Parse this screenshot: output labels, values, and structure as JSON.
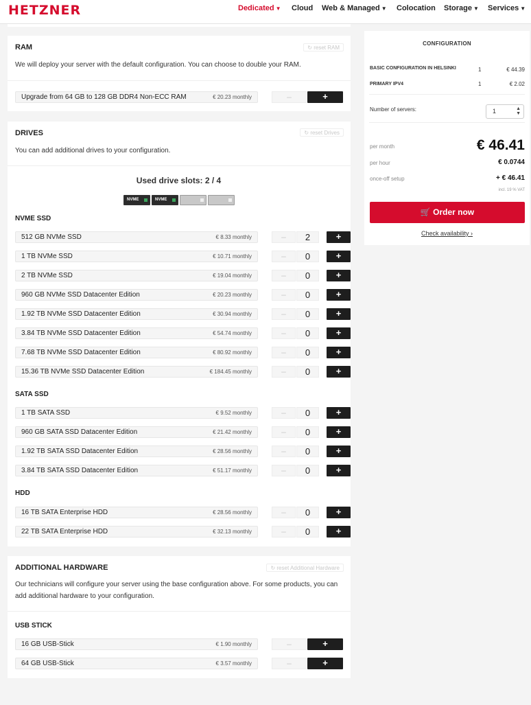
{
  "brand": {
    "logo": "HETZNER",
    "accent": "#d50c2d"
  },
  "nav": [
    {
      "label": "Dedicated",
      "dropdown": true,
      "active": true
    },
    {
      "label": "Cloud",
      "dropdown": false
    },
    {
      "label": "Web & Managed",
      "dropdown": true
    },
    {
      "label": "Colocation",
      "dropdown": false
    },
    {
      "label": "Storage",
      "dropdown": true
    },
    {
      "label": "Services",
      "dropdown": true
    }
  ],
  "ram": {
    "title": "RAM",
    "reset": "reset RAM",
    "desc": "We will deploy your server with the default configuration. You can choose to double your RAM.",
    "option": {
      "name": "Upgrade from 64 GB to 128 GB DDR4 Non-ECC RAM",
      "price": "€ 20.23 monthly"
    }
  },
  "drives": {
    "title": "DRIVES",
    "reset": "reset Drives",
    "desc": "You can add additional drives to your configuration.",
    "slots_title": "Used drive slots: 2 / 4",
    "slots": [
      {
        "label": "NVME",
        "filled": true
      },
      {
        "label": "NVME",
        "filled": true
      },
      {
        "label": "",
        "filled": false
      },
      {
        "label": "",
        "filled": false
      }
    ],
    "nvme": {
      "title": "NVME SSD",
      "items": [
        {
          "name": "512 GB NVMe SSD",
          "price": "€ 8.33 monthly",
          "qty": "2"
        },
        {
          "name": "1 TB NVMe SSD",
          "price": "€ 10.71 monthly",
          "qty": "0"
        },
        {
          "name": "2 TB NVMe SSD",
          "price": "€ 19.04 monthly",
          "qty": "0"
        },
        {
          "name": "960 GB NVMe SSD Datacenter Edition",
          "price": "€ 20.23 monthly",
          "qty": "0"
        },
        {
          "name": "1.92 TB NVMe SSD Datacenter Edition",
          "price": "€ 30.94 monthly",
          "qty": "0"
        },
        {
          "name": "3.84 TB NVMe SSD Datacenter Edition",
          "price": "€ 54.74 monthly",
          "qty": "0"
        },
        {
          "name": "7.68 TB NVMe SSD Datacenter Edition",
          "price": "€ 80.92 monthly",
          "qty": "0"
        },
        {
          "name": "15.36 TB NVMe SSD Datacenter Edition",
          "price": "€ 184.45 monthly",
          "qty": "0"
        }
      ]
    },
    "sata": {
      "title": "SATA SSD",
      "items": [
        {
          "name": "1 TB SATA SSD",
          "price": "€ 9.52 monthly",
          "qty": "0"
        },
        {
          "name": "960 GB SATA SSD Datacenter Edition",
          "price": "€ 21.42 monthly",
          "qty": "0"
        },
        {
          "name": "1.92 TB SATA SSD Datacenter Edition",
          "price": "€ 28.56 monthly",
          "qty": "0"
        },
        {
          "name": "3.84 TB SATA SSD Datacenter Edition",
          "price": "€ 51.17 monthly",
          "qty": "0"
        }
      ]
    },
    "hdd": {
      "title": "HDD",
      "items": [
        {
          "name": "16 TB SATA Enterprise HDD",
          "price": "€ 28.56 monthly",
          "qty": "0"
        },
        {
          "name": "22 TB SATA Enterprise HDD",
          "price": "€ 32.13 monthly",
          "qty": "0"
        }
      ]
    }
  },
  "hardware": {
    "title": "ADDITIONAL HARDWARE",
    "reset": "reset Additional Hardware",
    "desc": "Our technicians will configure your server using the base configuration above. For some products, you can add additional hardware to your configuration.",
    "usb": {
      "title": "USB STICK",
      "items": [
        {
          "name": "16 GB USB-Stick",
          "price": "€ 1.90 monthly"
        },
        {
          "name": "64 GB USB-Stick",
          "price": "€ 3.57 monthly"
        }
      ]
    }
  },
  "config": {
    "title": "CONFIGURATION",
    "lines": [
      {
        "label": "BASIC CONFIGURATION IN HELSINKI",
        "qty": "1",
        "price": "€ 44.39"
      },
      {
        "label": "PRIMARY IPV4",
        "qty": "1",
        "price": "€ 2.02"
      }
    ],
    "servers_label": "Number of servers:",
    "servers_value": "1",
    "per_month_label": "per month",
    "per_month": "€ 46.41",
    "per_hour_label": "per hour",
    "per_hour": "€ 0.0744",
    "setup_label": "once-off setup",
    "setup": "+ € 46.41",
    "vat": "incl. 19 % VAT",
    "order": "Order now",
    "check": "Check availability"
  },
  "buttons": {
    "minus": "–",
    "plus": "+"
  }
}
